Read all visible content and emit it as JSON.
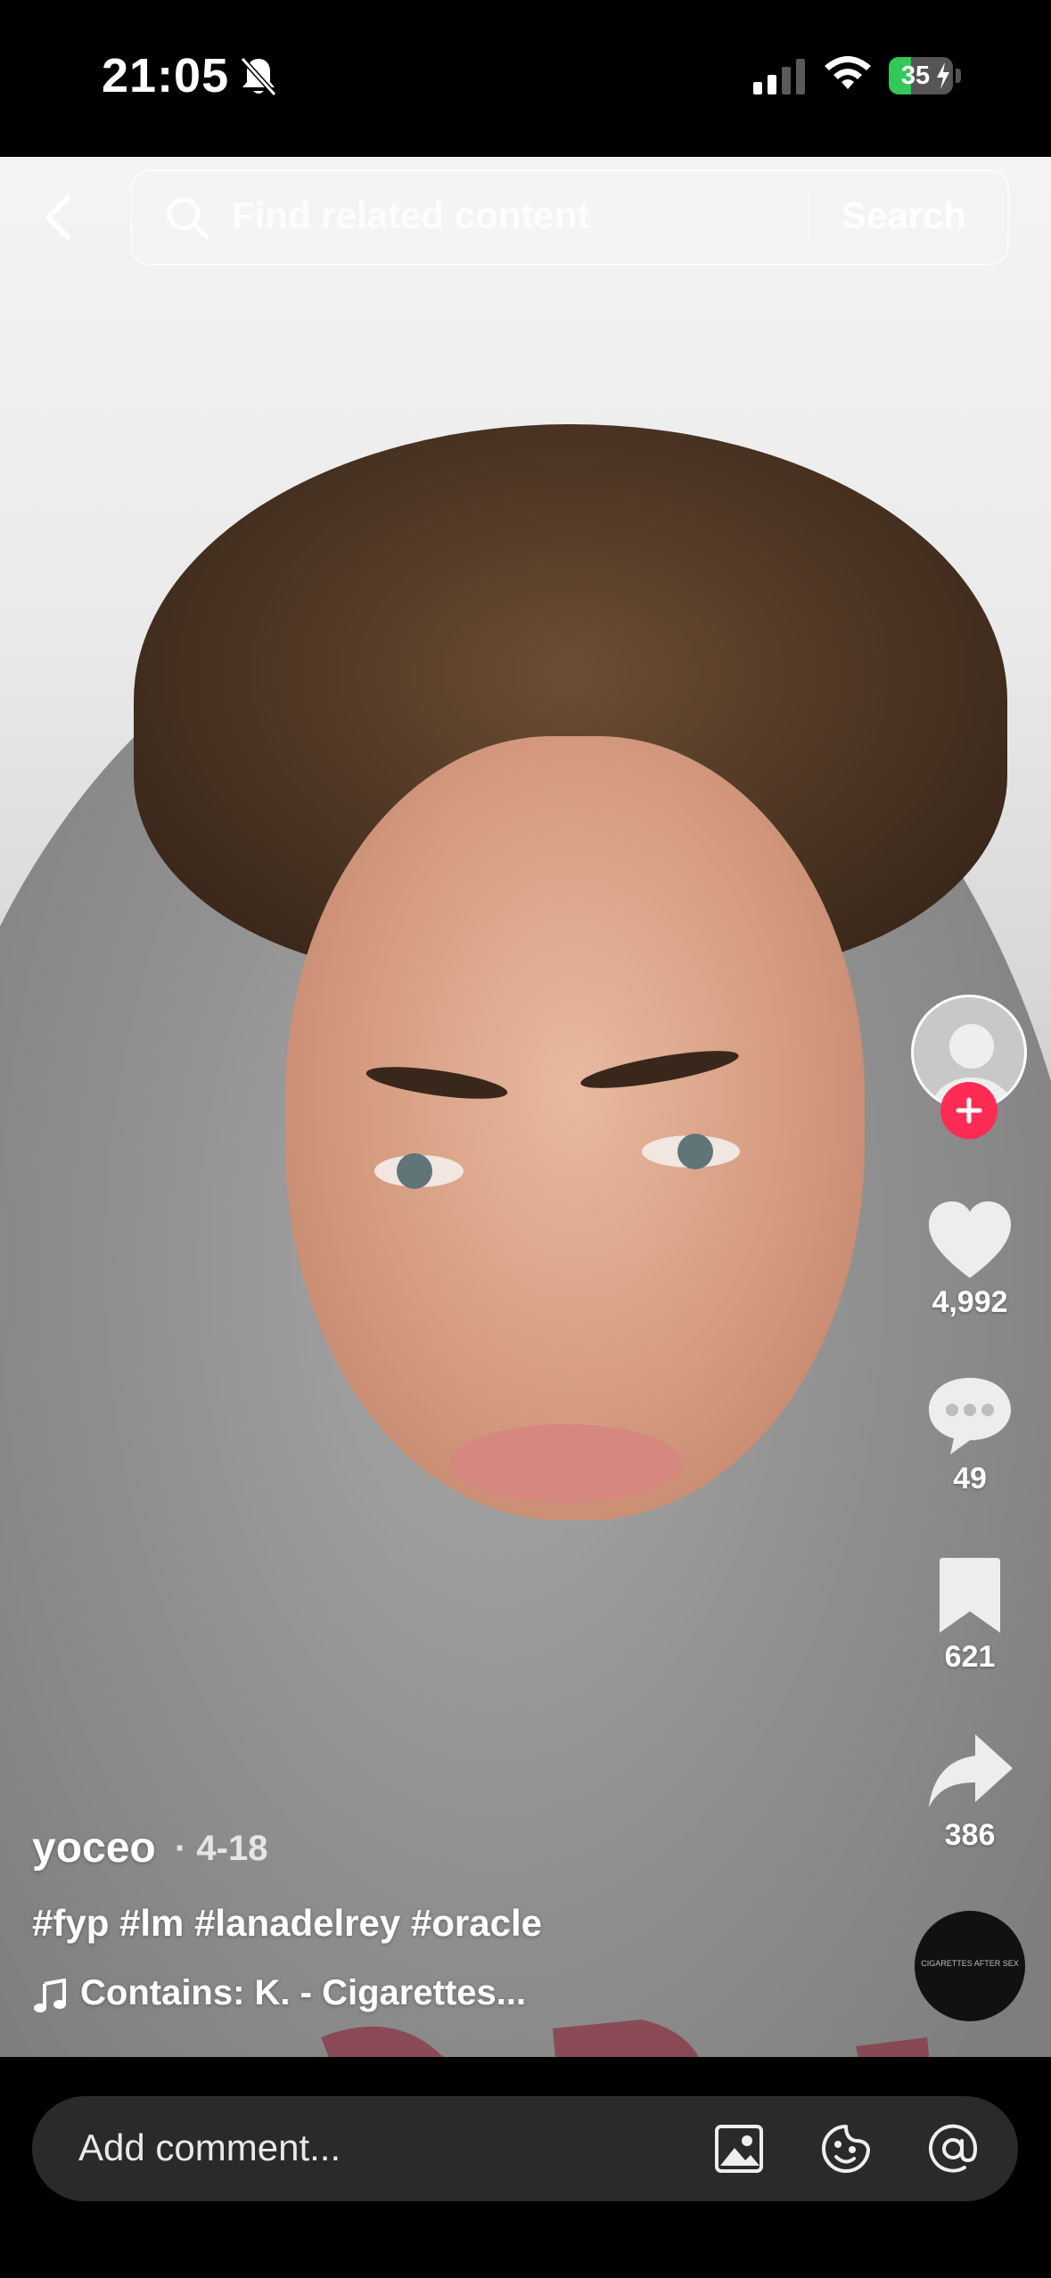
{
  "status_bar": {
    "time": "21:05",
    "battery_percent": "35",
    "icons": [
      "bell-slash-icon",
      "cellular-signal-icon",
      "wifi-icon",
      "battery-charging-icon"
    ]
  },
  "search": {
    "placeholder": "Find related content",
    "button_label": "Search"
  },
  "actions": {
    "likes": "4,992",
    "comments": "49",
    "saves": "621",
    "shares": "386"
  },
  "caption": {
    "author": "yoceo",
    "date": "· 4-18",
    "hashtags": "#fyp #lm #lanadelrey #oracle",
    "music": "Contains: K. - Cigarettes..."
  },
  "music_disc_label": "CIGARETTES AFTER SEX",
  "comment_bar": {
    "placeholder": "Add comment..."
  },
  "colors": {
    "accent": "#fe2c55",
    "battery": "#34c759"
  }
}
